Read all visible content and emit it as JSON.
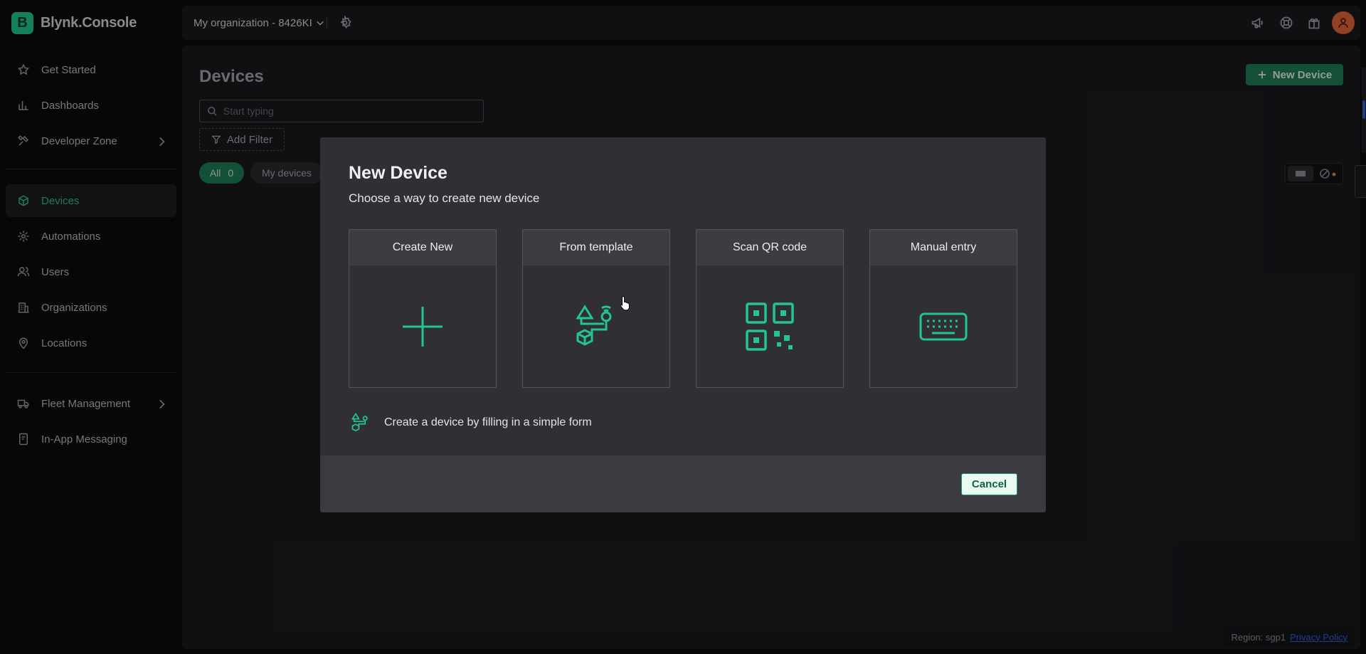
{
  "app": {
    "brand_letter": "B",
    "brand_name": "Blynk.Console",
    "accent_color": "#23c48e"
  },
  "sidebar": {
    "items": [
      {
        "label": "Get Started",
        "icon": "star-icon"
      },
      {
        "label": "Dashboards",
        "icon": "bar-chart-icon"
      },
      {
        "label": "Developer Zone",
        "icon": "tools-icon",
        "has_submenu": true
      },
      {
        "label": "Devices",
        "icon": "cube-icon",
        "active": true
      },
      {
        "label": "Automations",
        "icon": "automation-icon"
      },
      {
        "label": "Users",
        "icon": "users-icon"
      },
      {
        "label": "Organizations",
        "icon": "building-icon"
      },
      {
        "label": "Locations",
        "icon": "map-pin-icon"
      },
      {
        "label": "Fleet Management",
        "icon": "truck-icon",
        "has_submenu": true
      },
      {
        "label": "In-App Messaging",
        "icon": "messaging-icon"
      }
    ]
  },
  "topbar": {
    "org_name": "My organization - 8426KI",
    "icons": [
      "megaphone-icon",
      "help-lifebuoy-icon",
      "gift-icon",
      "user-avatar-icon"
    ]
  },
  "page": {
    "title": "Devices",
    "new_device_label": "New Device",
    "search_placeholder": "Start typing",
    "add_filter_label": "Add Filter",
    "tabs": {
      "all_label": "All",
      "all_count": "0",
      "my_devices_label": "My devices"
    }
  },
  "modal": {
    "title": "New Device",
    "subtitle": "Choose a way to create new device",
    "options": [
      {
        "label": "Create New",
        "icon": "plus-icon"
      },
      {
        "label": "From template",
        "icon": "template-icon"
      },
      {
        "label": "Scan QR code",
        "icon": "qr-code-icon"
      },
      {
        "label": "Manual entry",
        "icon": "keyboard-icon"
      }
    ],
    "hint": "Create a device by filling in a simple form",
    "cancel_label": "Cancel"
  },
  "footer": {
    "region_label": "Region: sgp1",
    "privacy_label": "Privacy Policy"
  }
}
